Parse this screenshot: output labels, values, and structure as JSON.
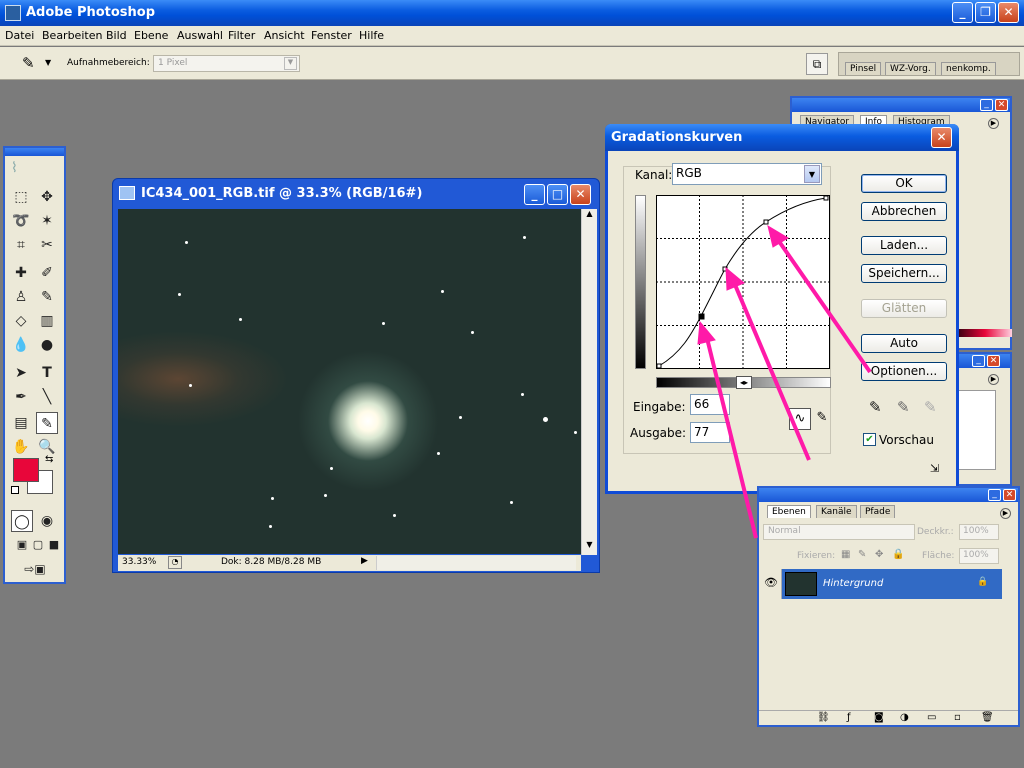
{
  "app": {
    "title": "Adobe Photoshop"
  },
  "menu": [
    "Datei",
    "Bearbeiten",
    "Bild",
    "Ebene",
    "Auswahl",
    "Filter",
    "Ansicht",
    "Fenster",
    "Hilfe"
  ],
  "options_bar": {
    "sample_label": "Aufnahmebereich:",
    "sample_value": "1 Pixel",
    "palette_tabs": [
      "Pinsel",
      "WZ-Vorg.",
      "nenkomp."
    ]
  },
  "document": {
    "title": "IC434_001_RGB.tif @ 33.3% (RGB/16#)",
    "zoom": "33.33%",
    "doc_info": "Dok: 8.28 MB/8.28 MB"
  },
  "navigator_panel": {
    "tabs": [
      "Navigator",
      "Info",
      "Histogram"
    ]
  },
  "curves": {
    "title": "Gradationskurven",
    "channel_label": "Kanal:",
    "channel_value": "RGB",
    "input_label": "Eingabe:",
    "input_value": "66",
    "output_label": "Ausgabe:",
    "output_value": "77",
    "buttons": {
      "ok": "OK",
      "cancel": "Abbrechen",
      "load": "Laden...",
      "save": "Speichern...",
      "smooth": "Glätten",
      "auto": "Auto",
      "options": "Optionen..."
    },
    "preview_label": "Vorschau",
    "preview_checked": true
  },
  "layers_panel": {
    "tabs": [
      "Ebenen",
      "Kanäle",
      "Pfade"
    ],
    "blend_mode": "Normal",
    "opacity_label": "Deckkr.:",
    "opacity_value": "100%",
    "lock_label": "Fixieren:",
    "fill_label": "Fläche:",
    "fill_value": "100%",
    "layer_name": "Hintergrund"
  },
  "colors": {
    "foreground": "#e8063a",
    "background": "#ffffff",
    "annotation_arrows": "#ff1aa8",
    "selected_layer": "#316ac5"
  }
}
